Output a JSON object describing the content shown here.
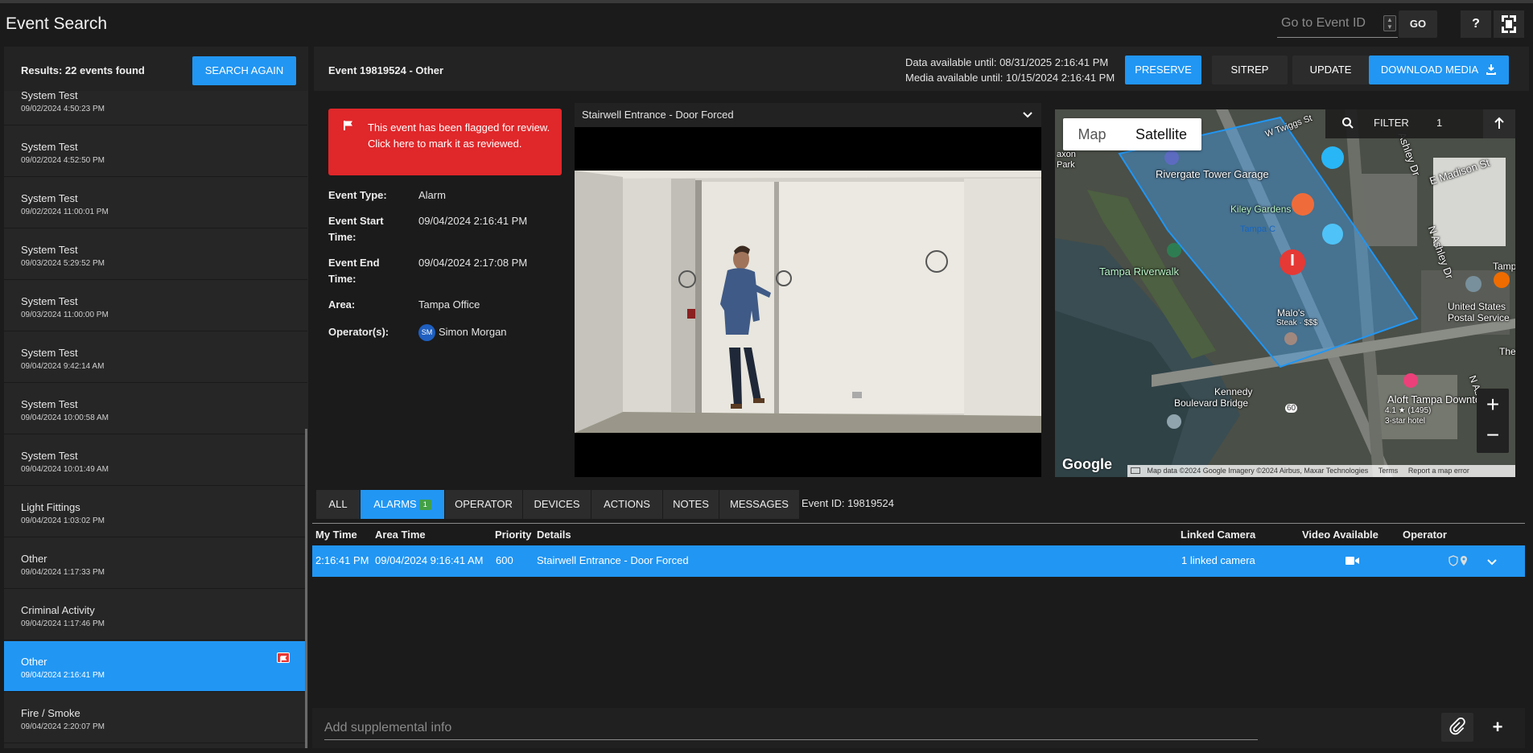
{
  "header": {
    "title": "Event Search",
    "goto_placeholder": "Go to Event ID",
    "go_label": "GO",
    "help_label": "?"
  },
  "left": {
    "results_label": "Results: 22 events found",
    "search_again_label": "SEARCH AGAIN",
    "events": [
      {
        "name": "System Test",
        "time": "09/02/2024 4:50:23 PM"
      },
      {
        "name": "System Test",
        "time": "09/02/2024 4:52:50 PM"
      },
      {
        "name": "System Test",
        "time": "09/02/2024 11:00:01 PM"
      },
      {
        "name": "System Test",
        "time": "09/03/2024 5:29:52 PM"
      },
      {
        "name": "System Test",
        "time": "09/03/2024 11:00:00 PM"
      },
      {
        "name": "System Test",
        "time": "09/04/2024 9:42:14 AM"
      },
      {
        "name": "System Test",
        "time": "09/04/2024 10:00:58 AM"
      },
      {
        "name": "System Test",
        "time": "09/04/2024 10:01:49 AM"
      },
      {
        "name": "Light Fittings",
        "time": "09/04/2024 1:03:02 PM"
      },
      {
        "name": "Other",
        "time": "09/04/2024 1:17:33 PM"
      },
      {
        "name": "Criminal Activity",
        "time": "09/04/2024 1:17:46 PM"
      },
      {
        "name": "Other",
        "time": "09/04/2024 2:16:41 PM"
      },
      {
        "name": "Fire / Smoke",
        "time": "09/04/2024 2:20:07 PM"
      }
    ]
  },
  "detail": {
    "event_title": "Event 19819524 - Other",
    "data_available": "Data available until: 08/31/2025 2:16:41 PM",
    "media_available": "Media available until: 10/15/2024 2:16:41 PM",
    "preserve_label": "PRESERVE",
    "sitrep_label": "SITREP",
    "update_label": "UPDATE",
    "download_label": "DOWNLOAD MEDIA",
    "flag_line1": "This event has been flagged for review.",
    "flag_line2": "Click here to mark it as reviewed.",
    "event_type_label": "Event Type:",
    "event_type": "Alarm",
    "start_label_1": "Event Start",
    "start_label_2": "Time:",
    "start_time": "09/04/2024 2:16:41 PM",
    "end_label_1": "Event End",
    "end_label_2": "Time:",
    "end_time": "09/04/2024 2:17:08 PM",
    "area_label": "Area:",
    "area": "Tampa Office",
    "operators_label": "Operator(s):",
    "operator_initials": "SM",
    "operator_name": "Simon Morgan"
  },
  "camera": {
    "title": "Stairwell Entrance - Door Forced"
  },
  "map": {
    "map_label": "Map",
    "satellite_label": "Satellite",
    "filter_label": "FILTER",
    "filter_count": "1",
    "google_label": "Google",
    "footer": "Map data ©2024 Google Imagery ©2024 Airbus, Maxar Technologies",
    "terms": "Terms",
    "report": "Report a map error",
    "labels": {
      "rivergate": "Rivergate Tower Garage",
      "kiley": "Kiley Gardens",
      "tampa_c": "Tampa C",
      "riverwalk": "Tampa Riverwalk",
      "kennedy1": "Kennedy",
      "kennedy2": "Boulevard Bridge",
      "aloft": "Aloft Tampa Downtown",
      "hotel_meta": "4.1 ★ (1495)",
      "hotel_type": "3-star hotel",
      "usps1": "United States",
      "usps2": "Postal Service",
      "maloos": "Malo's",
      "steak": "Steak · $$$",
      "ashley1": "N Ashley Dr",
      "ashley2": "Ashley Dr",
      "madison": "E Madison St",
      "twiggs": "W Twiggs St",
      "axon": "axon",
      "park": "Park",
      "tamp": "Tamp",
      "the": "The",
      "n_as": "N As",
      "road_60": "60"
    }
  },
  "tabs": [
    {
      "label": "ALL"
    },
    {
      "label": "ALARMS",
      "badge": "1"
    },
    {
      "label": "OPERATOR"
    },
    {
      "label": "DEVICES"
    },
    {
      "label": "ACTIONS"
    },
    {
      "label": "NOTES"
    },
    {
      "label": "MESSAGES"
    }
  ],
  "event_id_text": "Event ID: 19819524",
  "table": {
    "headers": [
      "My Time",
      "Area Time",
      "Priority",
      "Details",
      "Linked Camera",
      "Video Available",
      "Operator"
    ],
    "rows": [
      {
        "my_time": "2:16:41 PM",
        "area_time": "09/04/2024 9:16:41 AM",
        "priority": "600",
        "details": "Stairwell Entrance - Door Forced",
        "linked": "1 linked camera"
      }
    ]
  },
  "supplemental": {
    "placeholder": "Add supplemental info",
    "add_label": "+"
  },
  "colors": {
    "accent": "#2196f3",
    "flag": "#e0272a",
    "badge": "#43a047"
  }
}
